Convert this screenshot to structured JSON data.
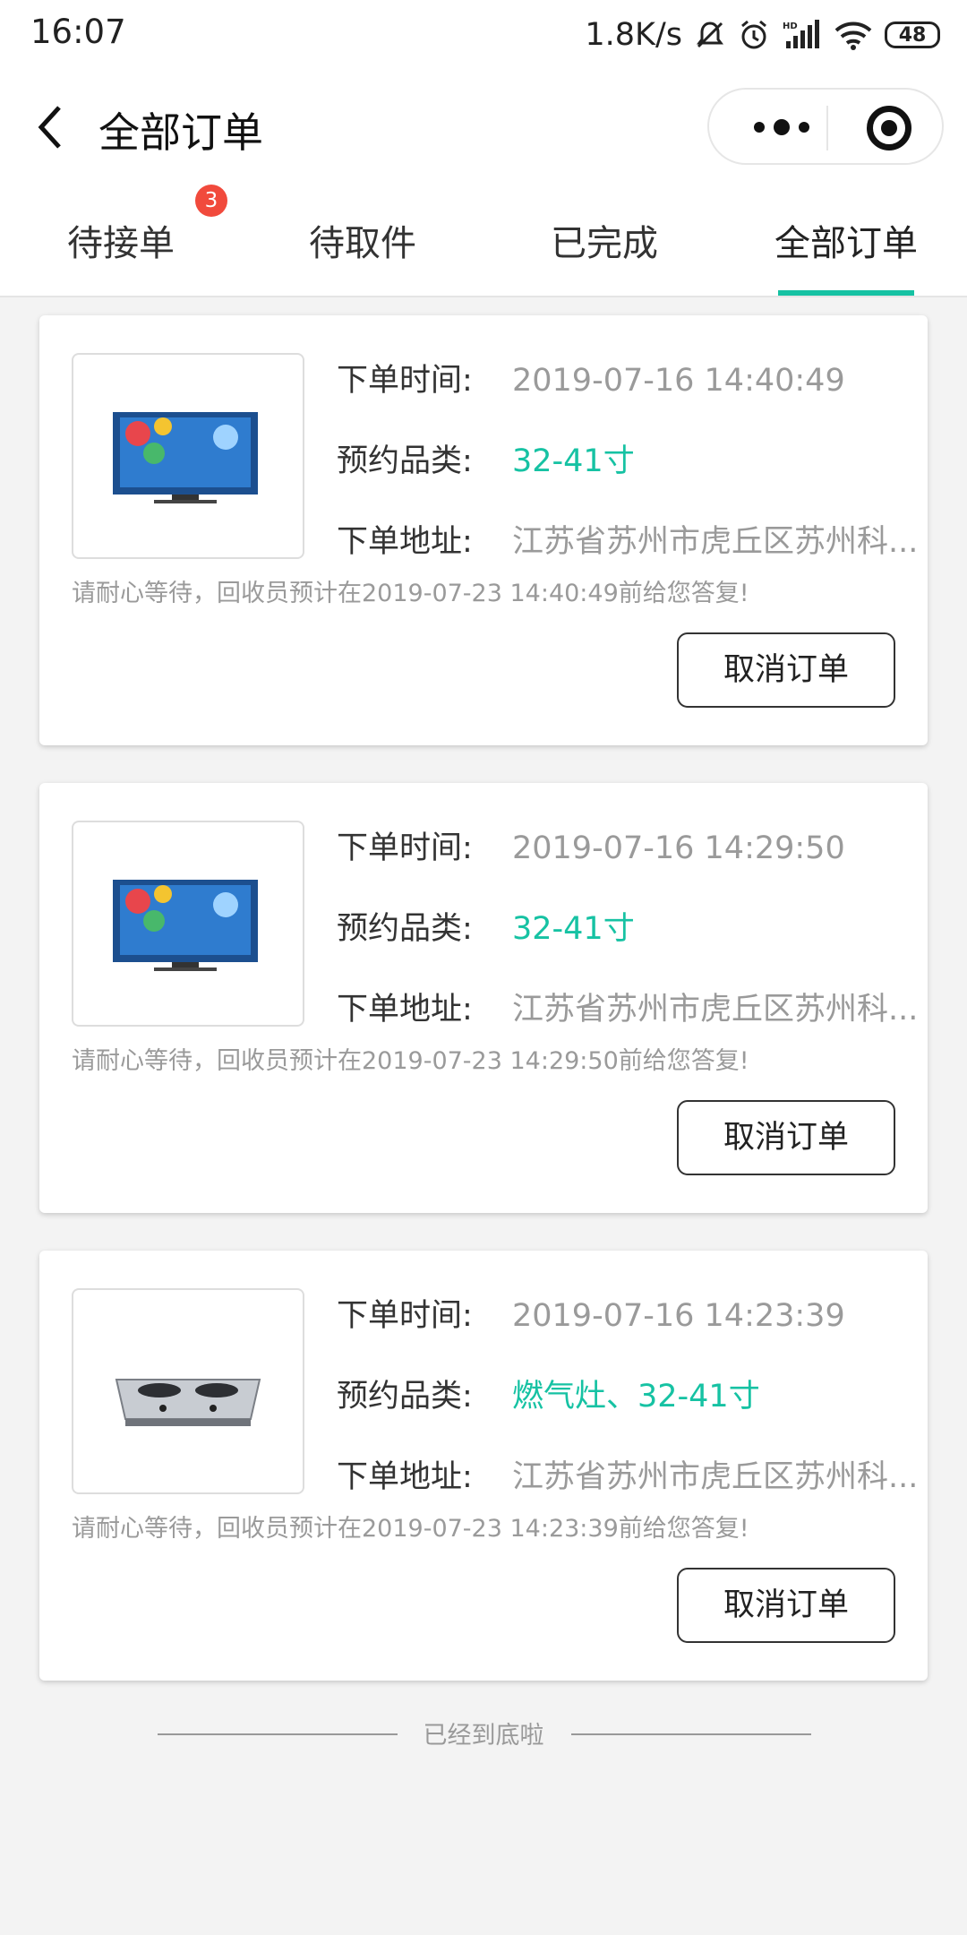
{
  "status_bar": {
    "time": "16:07",
    "net_speed": "1.8K/s",
    "battery": "48"
  },
  "nav": {
    "title": "全部订单"
  },
  "tabs": [
    {
      "label": "待接单",
      "badge": "3"
    },
    {
      "label": "待取件"
    },
    {
      "label": "已完成"
    },
    {
      "label": "全部订单",
      "active": true
    }
  ],
  "labels": {
    "time": "下单时间:",
    "category": "预约品类:",
    "address": "下单地址:",
    "cancel": "取消订单"
  },
  "orders": [
    {
      "time": "2019-07-16 14:40:49",
      "category": "32-41寸",
      "address": "江苏省苏州市虎丘区苏州科...",
      "hint": "请耐心等待，回收员预计在2019-07-23 14:40:49前给您答复!",
      "image": "tv"
    },
    {
      "time": "2019-07-16 14:29:50",
      "category": "32-41寸",
      "address": "江苏省苏州市虎丘区苏州科...",
      "hint": "请耐心等待，回收员预计在2019-07-23 14:29:50前给您答复!",
      "image": "tv"
    },
    {
      "time": "2019-07-16 14:23:39",
      "category": "燃气灶、32-41寸",
      "address": "江苏省苏州市虎丘区苏州科...",
      "hint": "请耐心等待，回收员预计在2019-07-23 14:23:39前给您答复!",
      "image": "gas-stove"
    }
  ],
  "footer": {
    "text": "已经到底啦"
  },
  "colors": {
    "accent": "#16c2a3",
    "badge": "#f14a3c",
    "muted": "#9a9a9a"
  }
}
